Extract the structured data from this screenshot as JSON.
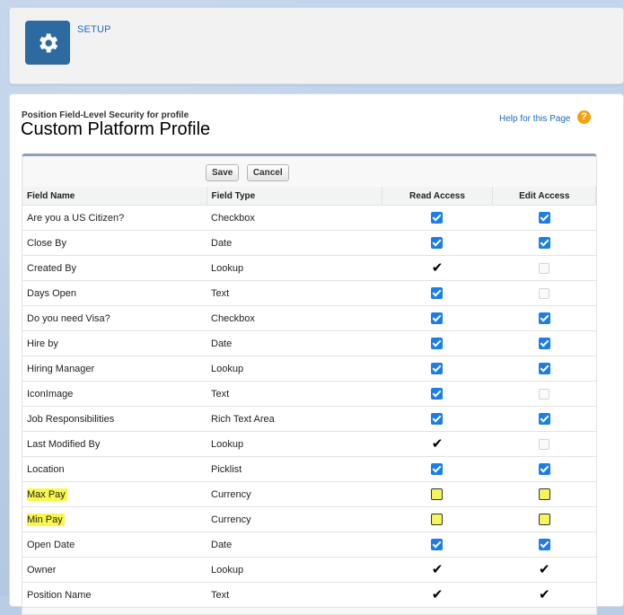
{
  "header": {
    "setup_label": "SETUP",
    "icon": "gear-icon"
  },
  "page": {
    "subtitle": "Position Field-Level Security for profile",
    "title": "Custom Platform Profile",
    "help_link": "Help for this Page",
    "help_icon": "?"
  },
  "buttons": {
    "save": "Save",
    "cancel": "Cancel"
  },
  "table": {
    "columns": [
      "Field Name",
      "Field Type",
      "Read Access",
      "Edit Access"
    ],
    "rows": [
      {
        "name": "Are you a US Citizen?",
        "type": "Checkbox",
        "read": "checked",
        "edit": "checked"
      },
      {
        "name": "Close By",
        "type": "Date",
        "read": "checked",
        "edit": "checked"
      },
      {
        "name": "Created By",
        "type": "Lookup",
        "read": "tick",
        "edit": "empty"
      },
      {
        "name": "Days Open",
        "type": "Text",
        "read": "checked",
        "edit": "empty"
      },
      {
        "name": "Do you need Visa?",
        "type": "Checkbox",
        "read": "checked",
        "edit": "checked"
      },
      {
        "name": "Hire by",
        "type": "Date",
        "read": "checked",
        "edit": "checked"
      },
      {
        "name": "Hiring Manager",
        "type": "Lookup",
        "read": "checked",
        "edit": "checked"
      },
      {
        "name": "IconImage",
        "type": "Text",
        "read": "checked",
        "edit": "empty"
      },
      {
        "name": "Job Responsibilities",
        "type": "Rich Text Area",
        "read": "checked",
        "edit": "checked"
      },
      {
        "name": "Last Modified By",
        "type": "Lookup",
        "read": "tick",
        "edit": "empty"
      },
      {
        "name": "Location",
        "type": "Picklist",
        "read": "checked",
        "edit": "checked"
      },
      {
        "name": "Max Pay",
        "type": "Currency",
        "read": "highlight",
        "edit": "highlight",
        "highlight": true
      },
      {
        "name": "Min Pay",
        "type": "Currency",
        "read": "highlight",
        "edit": "highlight",
        "highlight": true
      },
      {
        "name": "Open Date",
        "type": "Date",
        "read": "checked",
        "edit": "checked"
      },
      {
        "name": "Owner",
        "type": "Lookup",
        "read": "tick",
        "edit": "tick"
      },
      {
        "name": "Position Name",
        "type": "Text",
        "read": "tick",
        "edit": "tick"
      }
    ]
  },
  "colors": {
    "accent": "#1b7ee8",
    "highlight": "#f6f84a",
    "setup_tile": "#2d6aa0"
  }
}
